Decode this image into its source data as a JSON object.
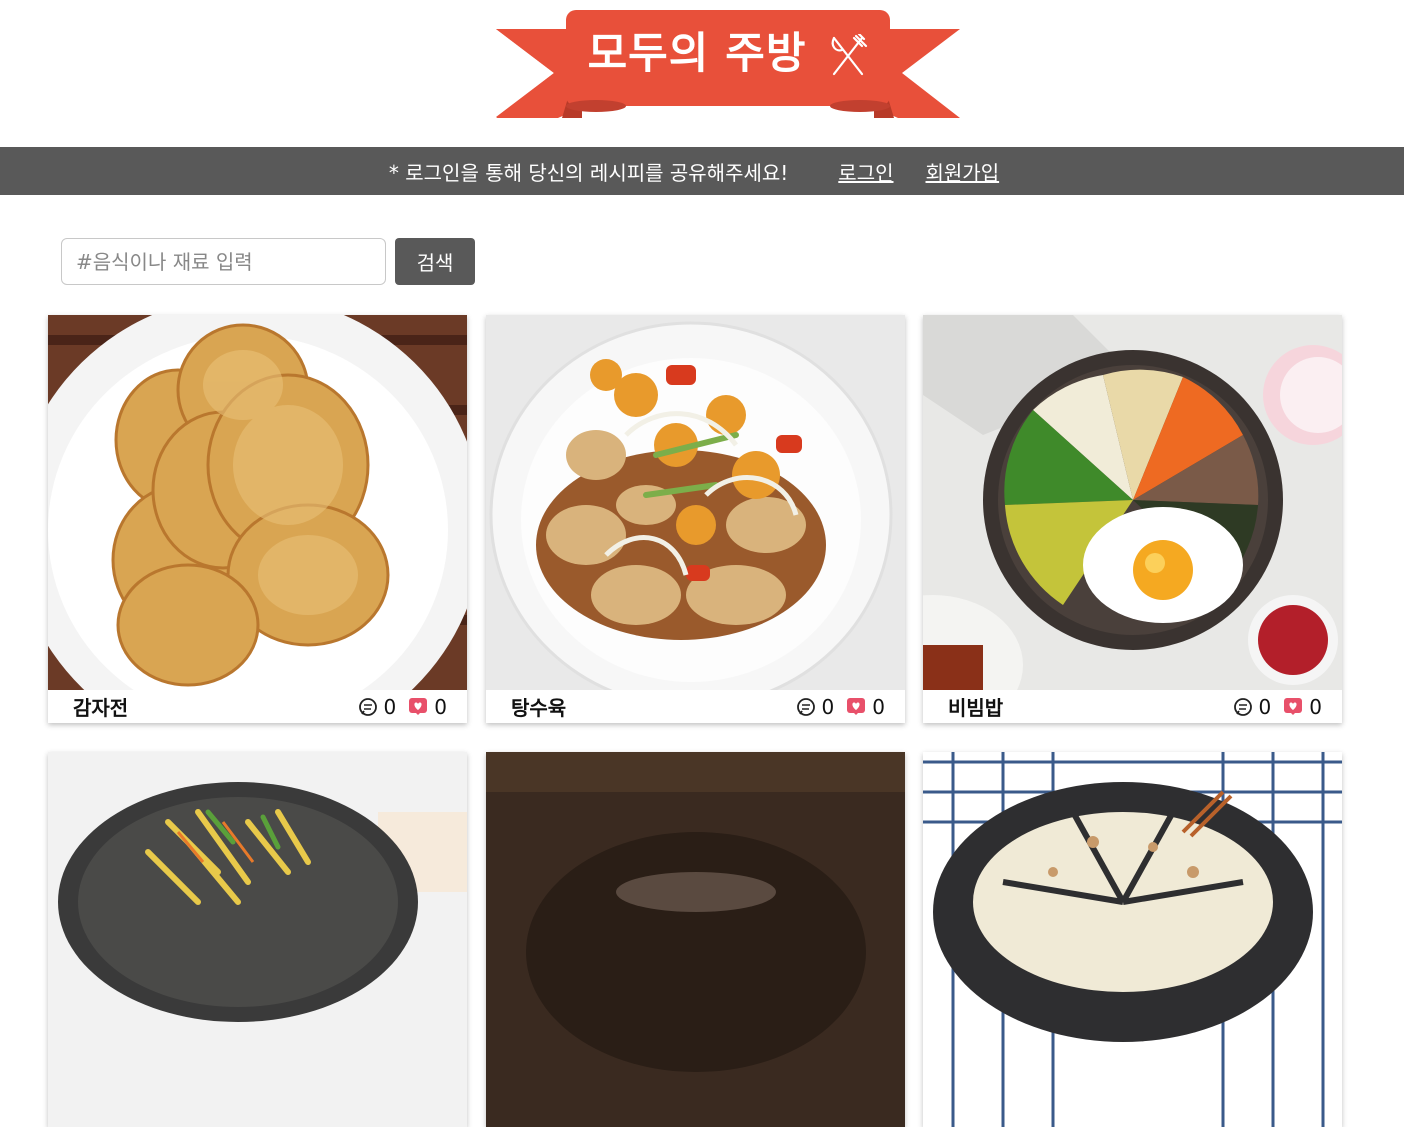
{
  "logo": {
    "title": "모두의 주방",
    "icon": "fork-knife-icon",
    "ribbon_color": "#e8503a"
  },
  "navbar": {
    "notice": "* 로그인을 통해 당신의 레시피를 공유해주세요!",
    "login_label": "로그인",
    "signup_label": "회원가입",
    "background": "#595959"
  },
  "search": {
    "placeholder": "#음식이나 재료 입력",
    "value": "",
    "button_label": "검색"
  },
  "cards": [
    {
      "title": "감자전",
      "comments": "0",
      "likes": "0",
      "image": "potato-pancake-photo"
    },
    {
      "title": "탕수육",
      "comments": "0",
      "likes": "0",
      "image": "sweet-sour-pork-photo"
    },
    {
      "title": "비빔밥",
      "comments": "0",
      "likes": "0",
      "image": "bibimbap-photo"
    },
    {
      "title": "",
      "image": "potato-stirfry-photo"
    },
    {
      "title": "",
      "image": "dark-bowl-photo"
    },
    {
      "title": "",
      "image": "pizza-pancake-photo"
    }
  ]
}
